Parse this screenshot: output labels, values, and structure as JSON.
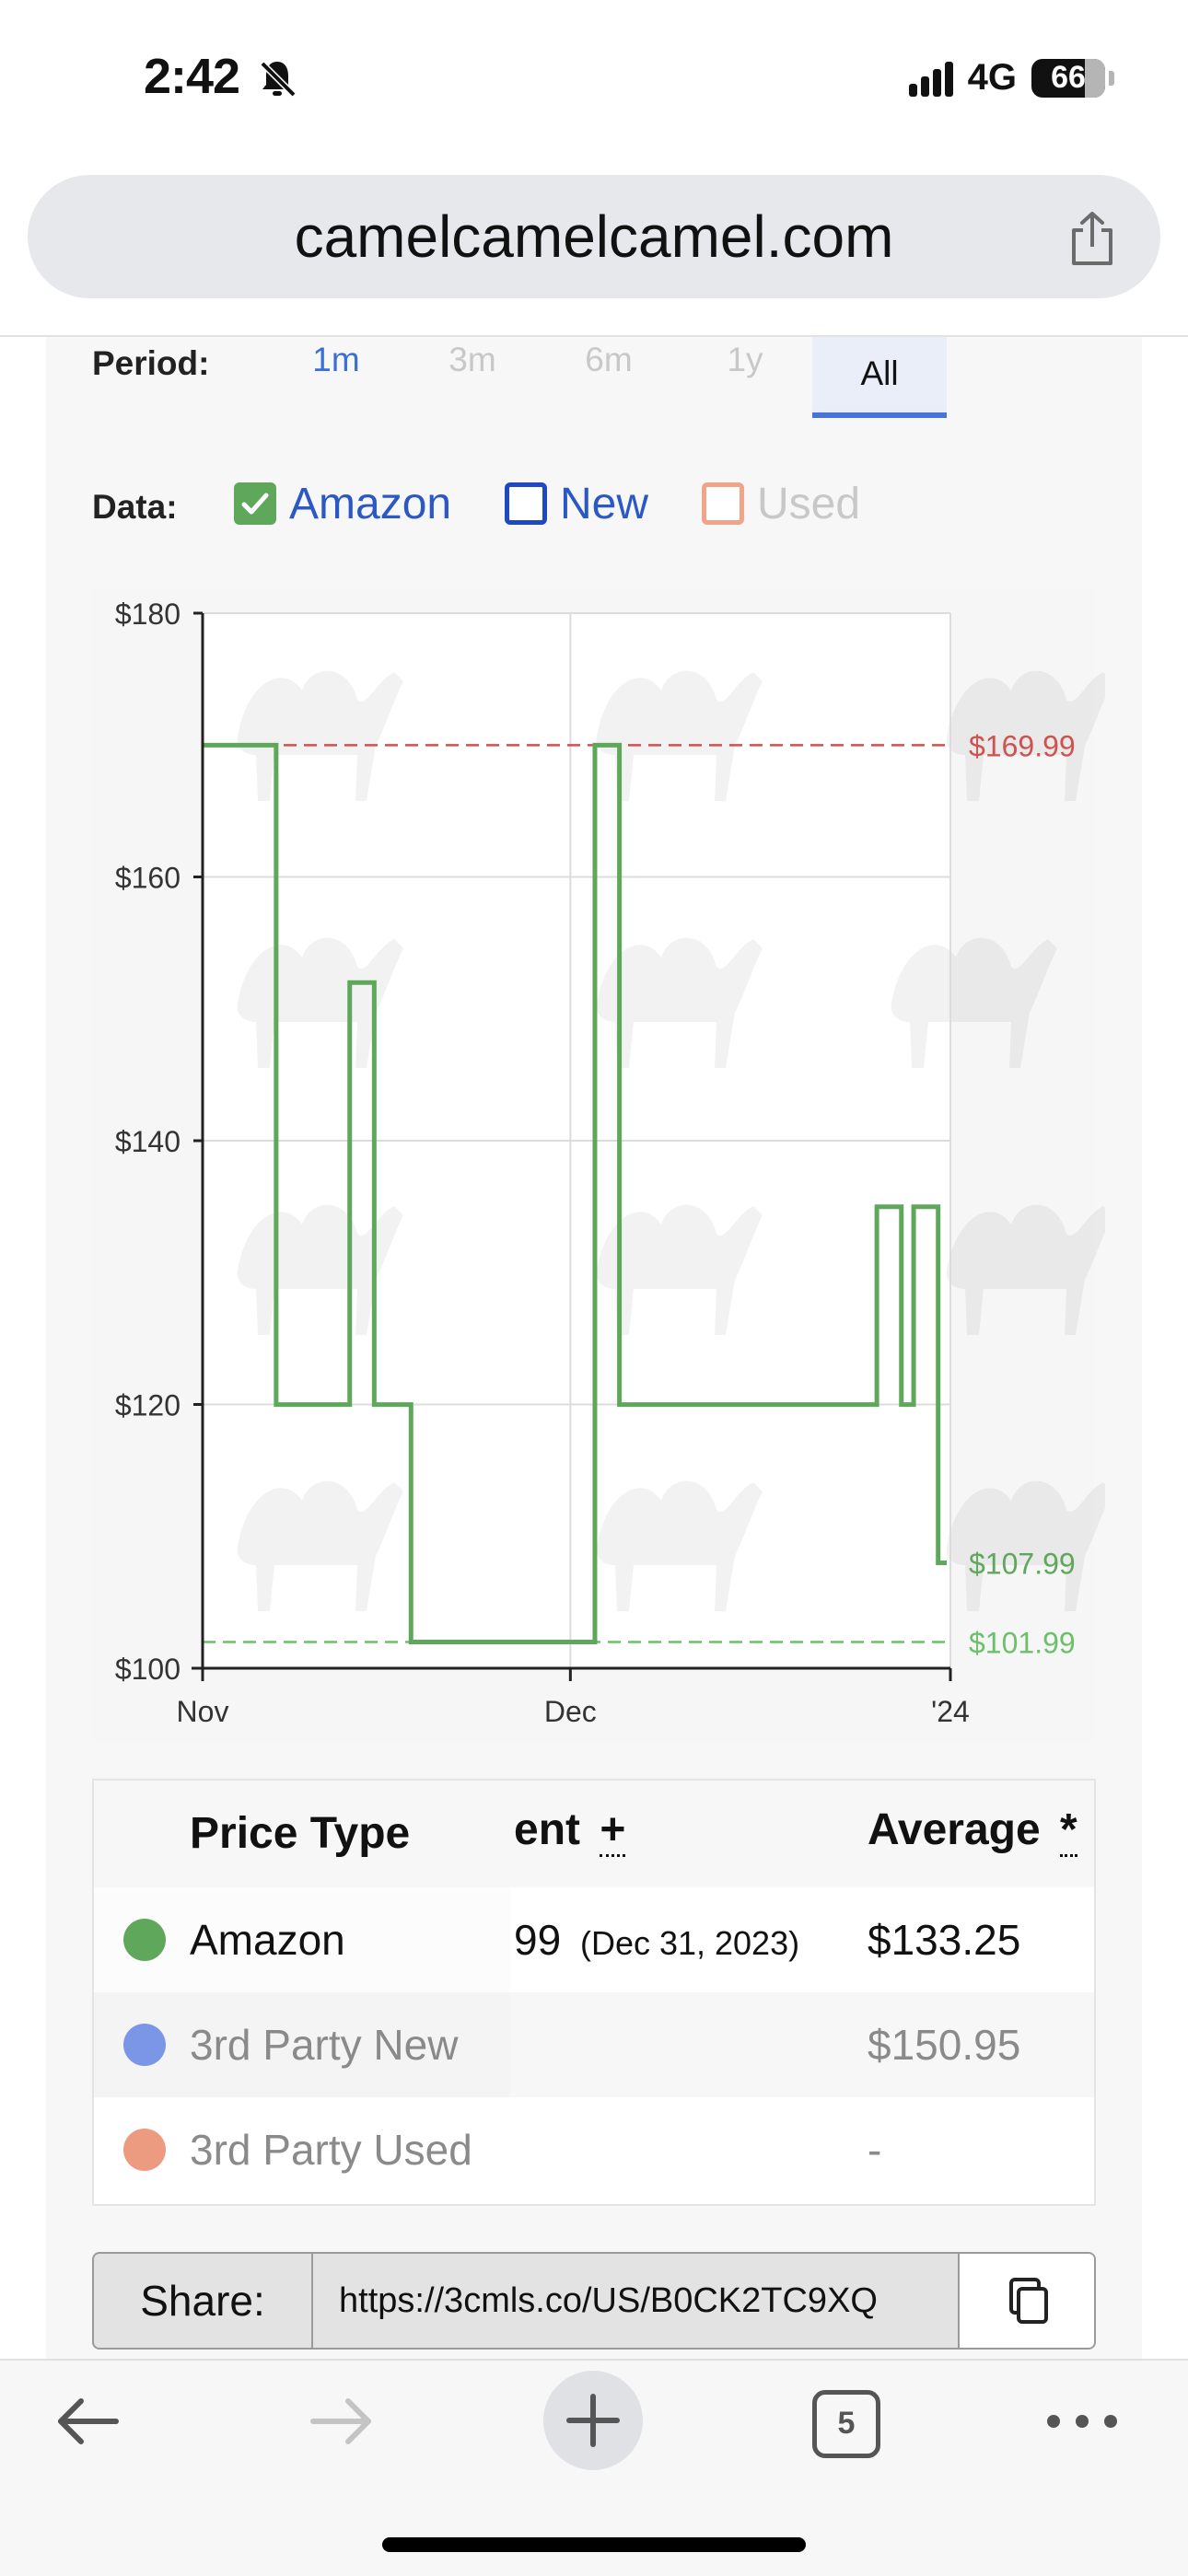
{
  "status_bar": {
    "time": "2:42",
    "network": "4G",
    "battery": "66"
  },
  "browser": {
    "url": "camelcamelcamel.com",
    "tab_count": "5"
  },
  "period": {
    "label": "Period:",
    "tabs": [
      {
        "label": "1m",
        "state": "enabled",
        "color": "#3b6fd8"
      },
      {
        "label": "3m",
        "state": "disabled",
        "color": "#c8c8c8"
      },
      {
        "label": "6m",
        "state": "disabled",
        "color": "#c8c8c8"
      },
      {
        "label": "1y",
        "state": "disabled",
        "color": "#c8c8c8"
      },
      {
        "label": "All",
        "state": "selected",
        "color": "#111111"
      }
    ]
  },
  "data_filter": {
    "label": "Data:",
    "options": [
      {
        "label": "Amazon",
        "checked": true,
        "color": "#5fa85b",
        "text_color": "#2b58c4"
      },
      {
        "label": "New",
        "checked": false,
        "color": "#1e49c2",
        "text_color": "#2b58c4"
      },
      {
        "label": "Used",
        "checked": false,
        "color": "#f0a58a",
        "text_color": "#c8c8c8"
      }
    ]
  },
  "chart_data": {
    "type": "line",
    "step": true,
    "y_tick_labels": [
      "$100",
      "$120",
      "$140",
      "$160",
      "$180"
    ],
    "x_tick_labels": [
      "Nov",
      "Dec",
      "'24"
    ],
    "ylim": [
      100,
      180
    ],
    "grid": true,
    "series": [
      {
        "name": "Amazon",
        "color": "#5fa85b",
        "points": [
          [
            "Nov 1",
            169.99
          ],
          [
            "Nov 7",
            119.99
          ],
          [
            "Nov 13",
            151.99
          ],
          [
            "Nov 15",
            119.99
          ],
          [
            "Nov 18",
            101.99
          ],
          [
            "Dec 3",
            169.99
          ],
          [
            "Dec 5",
            119.99
          ],
          [
            "Dec 26",
            134.99
          ],
          [
            "Dec 28",
            119.99
          ],
          [
            "Dec 29",
            134.99
          ],
          [
            "Dec 31",
            107.99
          ]
        ]
      }
    ],
    "reference_lines": [
      {
        "label": "$169.99",
        "value": 169.99,
        "color": "#d0524f"
      },
      {
        "label": "$101.99",
        "value": 101.99,
        "color": "#6cc06a"
      }
    ],
    "end_label": {
      "label": "$107.99",
      "value": 107.99,
      "color": "#5fa85b"
    }
  },
  "price_table": {
    "headers": {
      "type": "Price Type",
      "current_partial": "ent",
      "current_sort": "+",
      "average": "Average",
      "average_sort": "*"
    },
    "rows": [
      {
        "name": "Amazon",
        "current": "99",
        "current_date": "(Dec 31, 2023)",
        "average": "$133.25",
        "dot_color": "#5fa85b",
        "text_color": "#111111"
      },
      {
        "name": "3rd Party New",
        "current": "",
        "current_date": "",
        "average": "$150.95",
        "dot_color": "#7b96e6",
        "text_color": "#8a8a8a"
      },
      {
        "name": "3rd Party Used",
        "current": "",
        "current_date": "",
        "average": "-",
        "dot_color": "#ec9a80",
        "text_color": "#8a8a8a"
      }
    ]
  },
  "share": {
    "label": "Share:",
    "url": "https://3cmls.co/US/B0CK2TC9XQ"
  }
}
